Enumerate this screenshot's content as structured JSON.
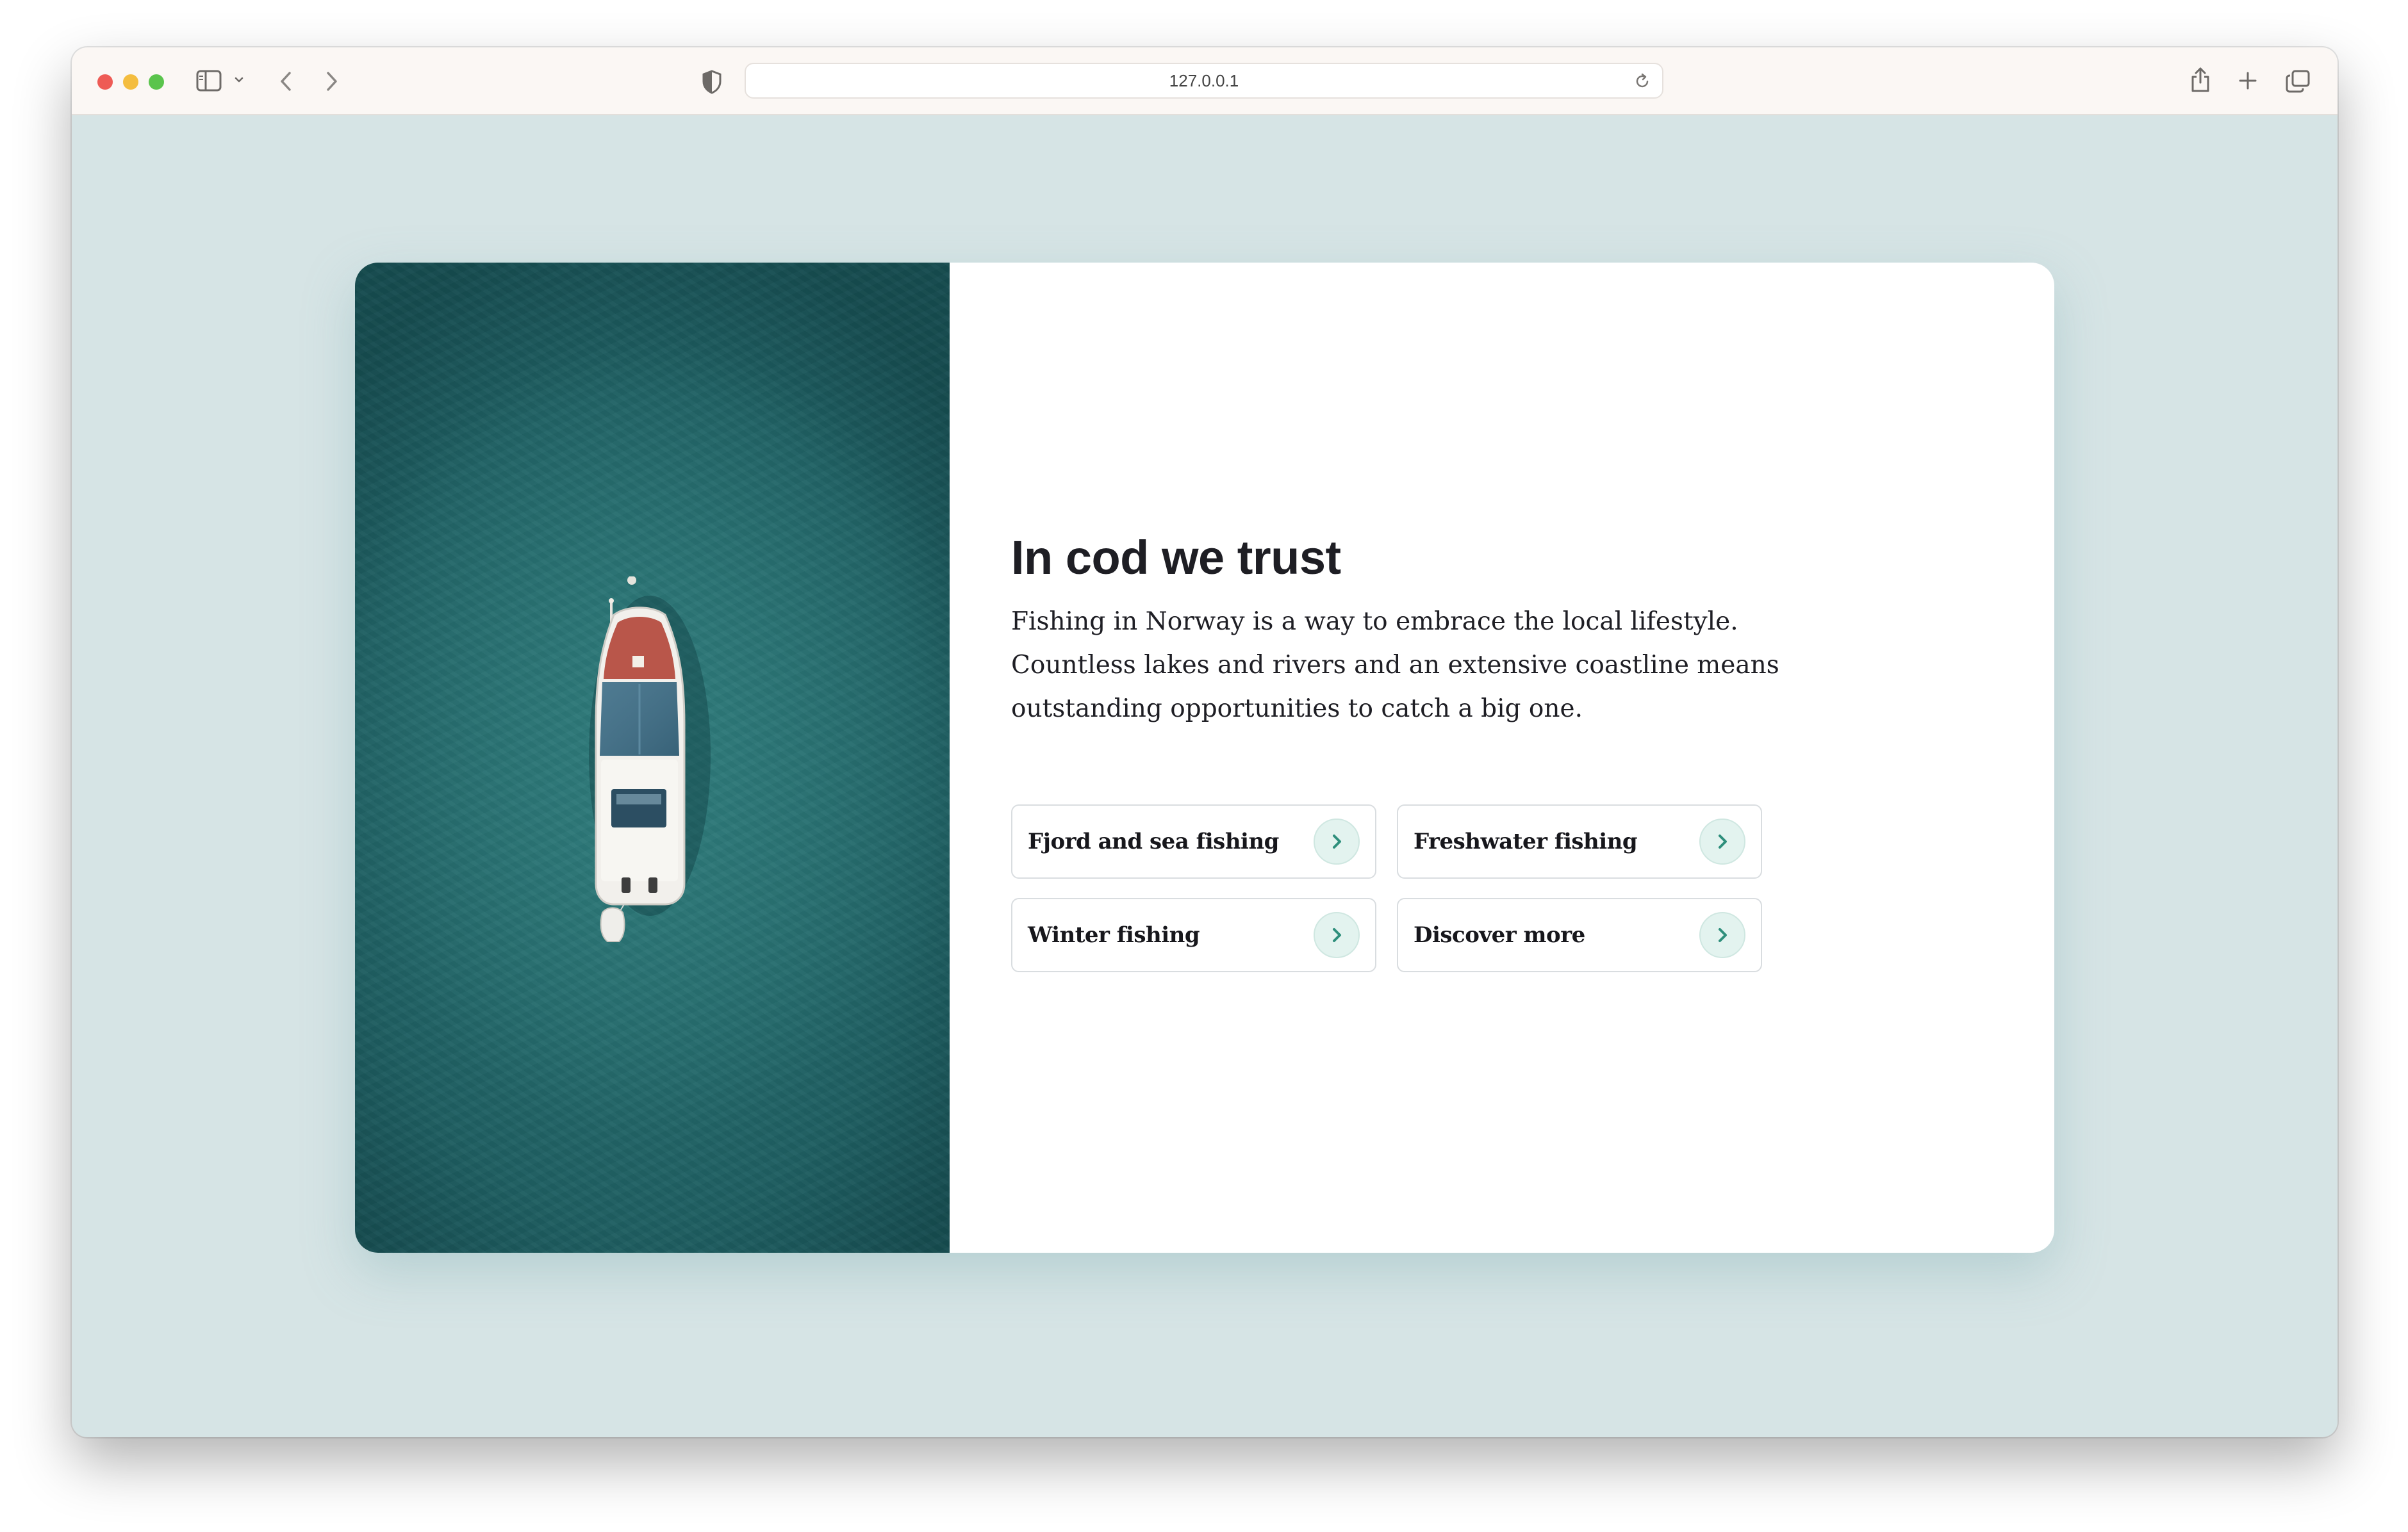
{
  "browser": {
    "url": "127.0.0.1"
  },
  "hero": {
    "title": "In cod we trust",
    "body": "Fishing in Norway is a way to embrace the local lifestyle. Countless lakes and rivers and an extensive coastline means outstanding opportunities to catch a big one.",
    "links": [
      {
        "label": "Fjord and sea fishing"
      },
      {
        "label": "Freshwater fishing"
      },
      {
        "label": "Winter fishing"
      },
      {
        "label": "Discover more"
      }
    ]
  },
  "colors": {
    "page_background": "#d6e4e5",
    "card_background": "#ffffff",
    "accent_chevron": "#2f8f7c",
    "chevron_circle": "#e3f3ef",
    "water": "#2b7575"
  },
  "icons": {
    "sidebar": "sidebar-icon",
    "back": "chevron-left-icon",
    "forward": "chevron-right-icon",
    "privacy": "shield-icon",
    "reload": "reload-icon",
    "share": "share-icon",
    "new_tab": "plus-icon",
    "tabs": "tabs-overview-icon",
    "link_arrow": "chevron-right-icon"
  }
}
